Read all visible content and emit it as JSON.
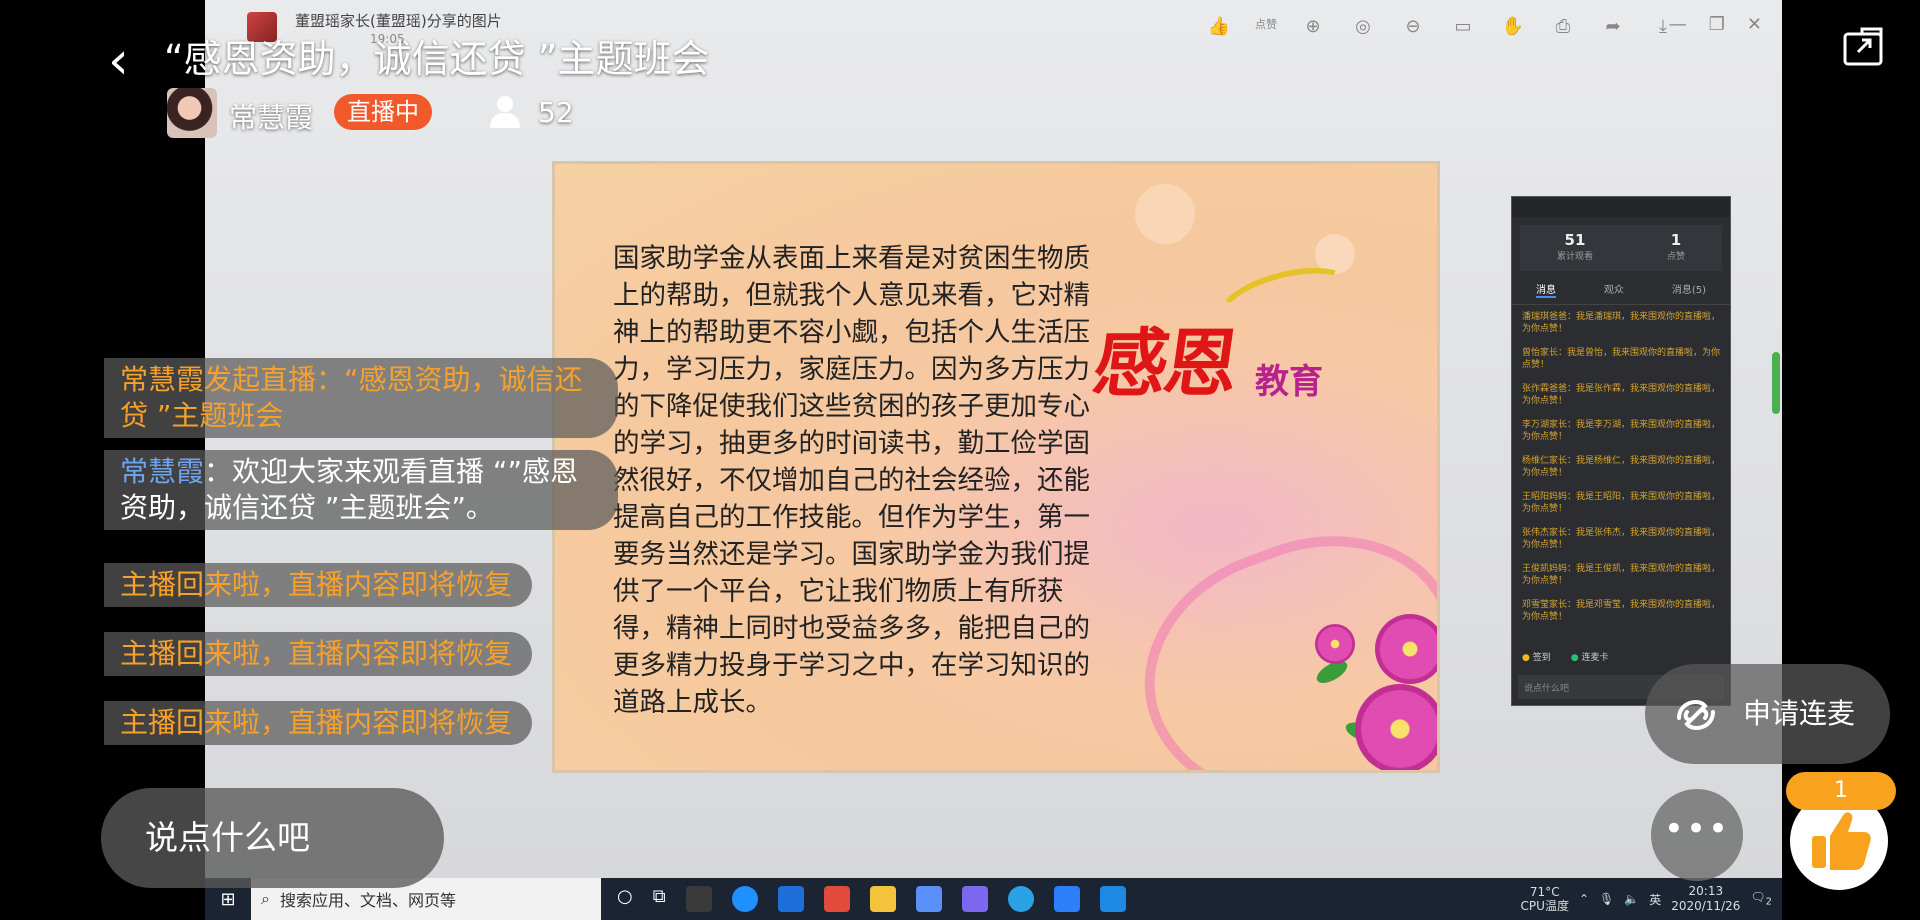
{
  "live": {
    "title": "“感恩资助，诚信还贷 ”主题班会",
    "host_name": "常慧霞",
    "status_badge": "直播中",
    "viewer_count": "52",
    "input_placeholder": "说点什么吧",
    "mic_request_label": "申请连麦",
    "like_count": "1",
    "colors": {
      "badge": "#f2592a",
      "like": "#f8a21e",
      "system_text": "#f7a12a",
      "user_name": "#6fa5f0"
    }
  },
  "comments": [
    {
      "type": "system",
      "text": "常慧霞发起直播：“感恩资助，诚信还贷 ”主题班会"
    },
    {
      "type": "user",
      "name": "常慧霞",
      "sep": "：",
      "text": "欢迎大家来观看直播 “”感恩资助，诚信还贷 ”主题班会”。"
    },
    {
      "type": "system",
      "text": "主播回来啦，直播内容即将恢复"
    },
    {
      "type": "system",
      "text": "主播回来啦，直播内容即将恢复"
    },
    {
      "type": "system",
      "text": "主播回来啦，直播内容即将恢复"
    }
  ],
  "screen": {
    "viewer_title": "董盟瑶家长(董盟瑶)分享的图片",
    "viewer_subtitle": "19:05",
    "like_label": "点赞",
    "slide": {
      "text": "国家助学金从表面上来看是对贫困生物质上的帮助，但就我个人意见来看，它对精神上的帮助更不容小觑，包括个人生活压力，学习压力，家庭压力。因为多方压力的下降促使我们这些贫困的孩子更加专心的学习，抽更多的时间读书，勤工俭学固然很好，不仅增加自己的社会经验，还能提高自己的工作技能。但作为学生，第一要务当然还是学习。国家助学金为我们提供了一个平台，它让我们物质上有所获得，精神上同时也受益多多，能把自己的更多精力投身于学习之中，在学习知识的道路上成长。",
      "logo_main": "感恩",
      "logo_sub": "教育"
    },
    "panel": {
      "stat1_value": "51",
      "stat1_label": "累计观看",
      "stat2_value": "1",
      "stat2_label": "点赞",
      "tabs": [
        "消息",
        "观众",
        "消息(5)"
      ],
      "messages": [
        "潘瑞琪爸爸：我是潘瑞琪，我来围观你的直播啦，为你点赞！",
        "曾怡家长：我是曾怡，我来围观你的直播啦，为你点赞！",
        "张作霖爸爸：我是张作霖，我来围观你的直播啦，为你点赞！",
        "李万湖家长：我是李万湖，我来围观你的直播啦，为你点赞！",
        "杨维仁家长：我是杨维仁，我来围观你的直播啦，为你点赞！",
        "王昭阳妈妈：我是王昭阳，我来围观你的直播啦，为你点赞！",
        "张伟杰家长：我是张伟杰，我来围观你的直播啦，为你点赞！",
        "王俊凯妈妈：我是王俊凯，我来围观你的直播啦，为你点赞！",
        "邓雪莹家长：我是邓雪莹，我来围观你的直播啦，为你点赞！"
      ],
      "foot_a": "签到",
      "foot_b": "连麦卡",
      "input_placeholder": "说点什么吧"
    },
    "taskbar": {
      "search_placeholder": "搜索应用、文档、网页等",
      "temp": "71°C",
      "temp_label": "CPU温度",
      "ime": "英",
      "time": "20:13",
      "date": "2020/11/26",
      "notify_count": "2"
    }
  }
}
